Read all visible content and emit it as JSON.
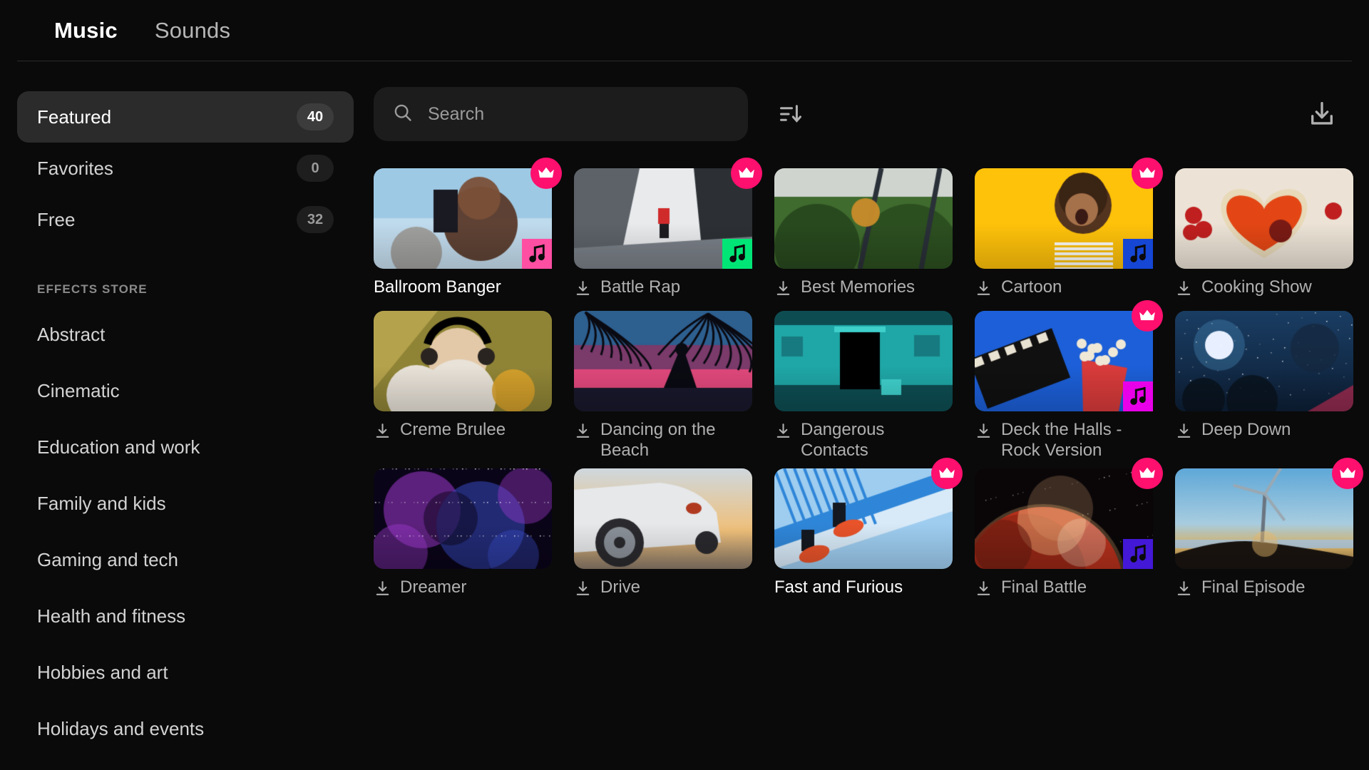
{
  "header": {
    "tabs": [
      {
        "label": "Music",
        "active": true
      },
      {
        "label": "Sounds",
        "active": false
      }
    ]
  },
  "sidebar": {
    "library": [
      {
        "label": "Featured",
        "badge": "40",
        "active": true
      },
      {
        "label": "Favorites",
        "badge": "0",
        "active": false
      },
      {
        "label": "Free",
        "badge": "32",
        "active": false
      }
    ],
    "section_title": "EFFECTS STORE",
    "categories": [
      {
        "label": "Abstract"
      },
      {
        "label": "Cinematic"
      },
      {
        "label": "Education and work"
      },
      {
        "label": "Family and kids"
      },
      {
        "label": "Gaming and tech"
      },
      {
        "label": "Health and fitness"
      },
      {
        "label": "Hobbies and art"
      },
      {
        "label": "Holidays and events"
      }
    ]
  },
  "toolbar": {
    "search_placeholder": "Search",
    "search_value": "",
    "search_icon": "search-icon",
    "sort_icon": "sort-descending-icon",
    "download_all_icon": "download-icon"
  },
  "colors": {
    "accent_crown": "#ff0f6e",
    "badge_pink": "#ff4fa3",
    "badge_green": "#00e676",
    "badge_blue": "#1546d4",
    "badge_magenta": "#e800e8",
    "badge_indigo": "#4318d6",
    "background": "#0a0a0a",
    "sidebar_active": "#2b2b2b",
    "search_bg": "#1c1c1c"
  },
  "grid": {
    "items": [
      {
        "title": "Ballroom Banger",
        "premium": true,
        "downloaded": true,
        "music_badge_color": "#ff4fa3",
        "thumb": "selfie-girl-city",
        "thumb_colors": [
          "#9ec9e4",
          "#c8dff0",
          "#5a3a2a",
          "#7a5038"
        ]
      },
      {
        "title": "Battle Rap",
        "premium": true,
        "downloaded": false,
        "music_badge_color": "#00e676",
        "thumb": "urban-buildings-runner",
        "thumb_colors": [
          "#e8eaec",
          "#5c6268",
          "#2c3034",
          "#d02b2b"
        ]
      },
      {
        "title": "Best Memories",
        "premium": false,
        "downloaded": false,
        "music_badge_color": null,
        "thumb": "train-forest-window",
        "thumb_colors": [
          "#cfd4cf",
          "#3f6b2e",
          "#25431b",
          "#c98c2a"
        ]
      },
      {
        "title": "Cartoon",
        "premium": true,
        "downloaded": false,
        "music_badge_color": "#1546d4",
        "thumb": "laughing-girl-yellow",
        "thumb_colors": [
          "#ffc20a",
          "#f5b800",
          "#53341f",
          "#ffffff"
        ]
      },
      {
        "title": "Cooking Show",
        "premium": false,
        "downloaded": false,
        "music_badge_color": null,
        "thumb": "heart-pizza-tomatoes",
        "thumb_colors": [
          "#ece3d6",
          "#e34614",
          "#c01f1f",
          "#e8d9a8"
        ]
      },
      {
        "title": "Creme Brulee",
        "premium": false,
        "downloaded": false,
        "music_badge_color": null,
        "thumb": "girl-headphones-olive",
        "thumb_colors": [
          "#8f8436",
          "#b5a24c",
          "#e8e2d8",
          "#d9a22a"
        ]
      },
      {
        "title": "Dancing on the Beach",
        "premium": false,
        "downloaded": false,
        "music_badge_color": null,
        "thumb": "palm-sunset-dancer",
        "thumb_colors": [
          "#2d5f8f",
          "#e0487c",
          "#0a0a12",
          "#7a3a7a"
        ]
      },
      {
        "title": "Dangerous Contacts",
        "premium": false,
        "downloaded": false,
        "music_badge_color": null,
        "thumb": "teal-abandoned-building",
        "thumb_colors": [
          "#1fa6a6",
          "#0d4d52",
          "#000000",
          "#3fd0cc"
        ]
      },
      {
        "title": "Deck the Halls - Rock Version",
        "premium": true,
        "downloaded": false,
        "music_badge_color": "#e800e8",
        "thumb": "clapperboard-popcorn-blue",
        "thumb_colors": [
          "#1c5fd8",
          "#101010",
          "#e8e2d2",
          "#d93b3b"
        ]
      },
      {
        "title": "Deep Down",
        "premium": false,
        "downloaded": false,
        "music_badge_color": null,
        "thumb": "moon-night-clouds",
        "thumb_colors": [
          "#1a3d63",
          "#0d1f36",
          "#e8f0ff",
          "#8e2a4e"
        ]
      },
      {
        "title": "Dreamer",
        "premium": false,
        "downloaded": false,
        "music_badge_color": null,
        "thumb": "purple-galaxy-nebula",
        "thumb_colors": [
          "#2a1050",
          "#a03ad0",
          "#3a50d0",
          "#0a0418"
        ]
      },
      {
        "title": "Drive",
        "premium": false,
        "downloaded": false,
        "music_badge_color": null,
        "thumb": "white-sportscar-sunset",
        "thumb_colors": [
          "#e6e8ea",
          "#f0c07a",
          "#2a2a2e",
          "#9aa0a6"
        ]
      },
      {
        "title": "Fast and Furious",
        "premium": true,
        "downloaded": true,
        "music_badge_color": null,
        "thumb": "blue-stairs-sneakers",
        "thumb_colors": [
          "#2f86d8",
          "#9ecdf0",
          "#e8532a",
          "#d8eaf8"
        ]
      },
      {
        "title": "Final Battle",
        "premium": true,
        "downloaded": false,
        "music_badge_color": "#4318d6",
        "thumb": "red-planet-space",
        "thumb_colors": [
          "#0a0608",
          "#b5301c",
          "#e8a070",
          "#f0d8c0"
        ]
      },
      {
        "title": "Final Episode",
        "premium": true,
        "downloaded": false,
        "music_badge_color": null,
        "thumb": "wind-turbine-sunset",
        "thumb_colors": [
          "#5fa8d8",
          "#e8c070",
          "#1a1410",
          "#c8dff0"
        ]
      }
    ]
  }
}
